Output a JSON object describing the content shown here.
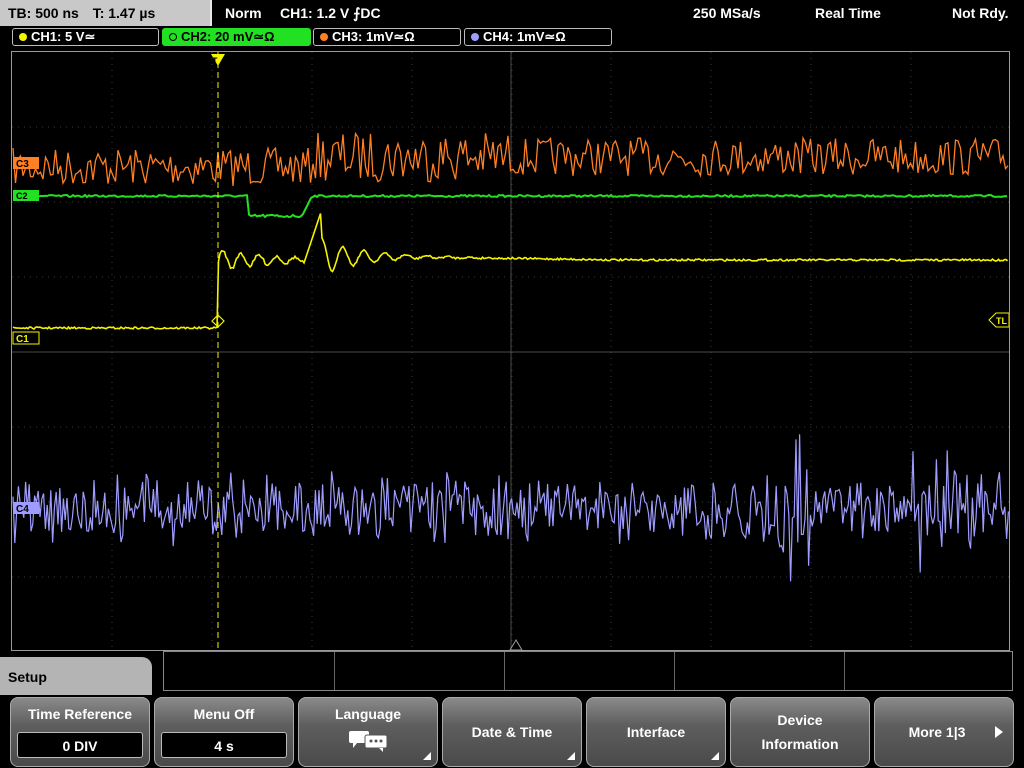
{
  "status": {
    "timebase": "TB: 500 ns",
    "trigger_time": "T: 1.47 µs",
    "mode": "Norm",
    "trigger": "CH1: 1.2 V ⨍DC",
    "sample_rate": "250 MSa/s",
    "acquisition": "Real Time",
    "state": "Not Rdy."
  },
  "channels": [
    {
      "label": "CH1: 5 V≃",
      "color": "#f4f400"
    },
    {
      "label": "CH2: 20 mV≃Ω",
      "color": "#22e022"
    },
    {
      "label": "CH3: 1mV≃Ω",
      "color": "#ff7f24"
    },
    {
      "label": "CH4: 1mV≃Ω",
      "color": "#9f9cff"
    }
  ],
  "scope": {
    "ch3_marker": "C3",
    "ch2_marker": "C2",
    "ch1_marker": "C1",
    "ch4_marker": "C4",
    "trigger_level_marker": "TL"
  },
  "menu": {
    "title": "Setup",
    "time_reference": {
      "label": "Time Reference",
      "value": "0 DIV"
    },
    "menu_off": {
      "label": "Menu Off",
      "value": "4 s"
    },
    "language": {
      "label": "Language",
      "icon": "speech-bubbles-icon"
    },
    "date_time": {
      "label": "Date & Time"
    },
    "interface": {
      "label": "Interface"
    },
    "device_info": {
      "label_1": "Device",
      "label_2": "Information"
    },
    "more": {
      "label": "More 1|3"
    }
  }
}
